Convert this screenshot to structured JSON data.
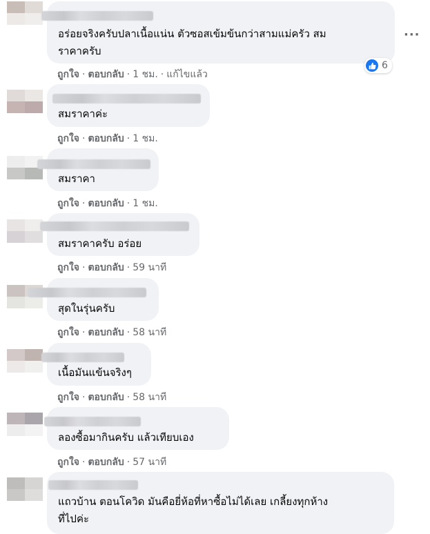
{
  "comments": [
    {
      "lines": [
        "อร่อยจริงครับปลาเนื้อแน่น ตัวซอสเข้มข้นกว่าสามแม่ครัว สม",
        "ราคาครับ"
      ],
      "time": "1 ชม.",
      "edited": "แก้ไขแล้ว",
      "reaction_count": "6"
    },
    {
      "lines": [
        "สมราคาค่ะ"
      ],
      "time": "1 ชม."
    },
    {
      "lines": [
        "สมราคา"
      ],
      "time": "1 ชม."
    },
    {
      "lines": [
        "สมราคาครับ อร่อย"
      ],
      "time": "59 นาที"
    },
    {
      "lines": [
        "สุดในรุ่นครับ"
      ],
      "time": "58 นาที"
    },
    {
      "lines": [
        "เนื้อมันแข้นจริงๆ"
      ],
      "time": "58 นาที"
    },
    {
      "lines": [
        "ลองซื้อมากินครับ แล้วเทียบเอง"
      ],
      "time": "57 นาที"
    },
    {
      "lines": [
        "แถวบ้าน ตอนโควิด มันคือยี่ห้อที่หาซื้อไม่ได้เลย เกลี้ยงทุกห้าง",
        "ที่ไปค่ะ"
      ]
    }
  ],
  "actions": {
    "like": "ถูกใจ",
    "reply": "ตอบกลับ",
    "separator": "·"
  },
  "icons": {
    "more": "more-options-icon",
    "like": "thumbs-up-icon"
  },
  "colors": {
    "bubble": "#f0f2f5",
    "muted": "#65676b",
    "like_blue": "#1877f2"
  }
}
